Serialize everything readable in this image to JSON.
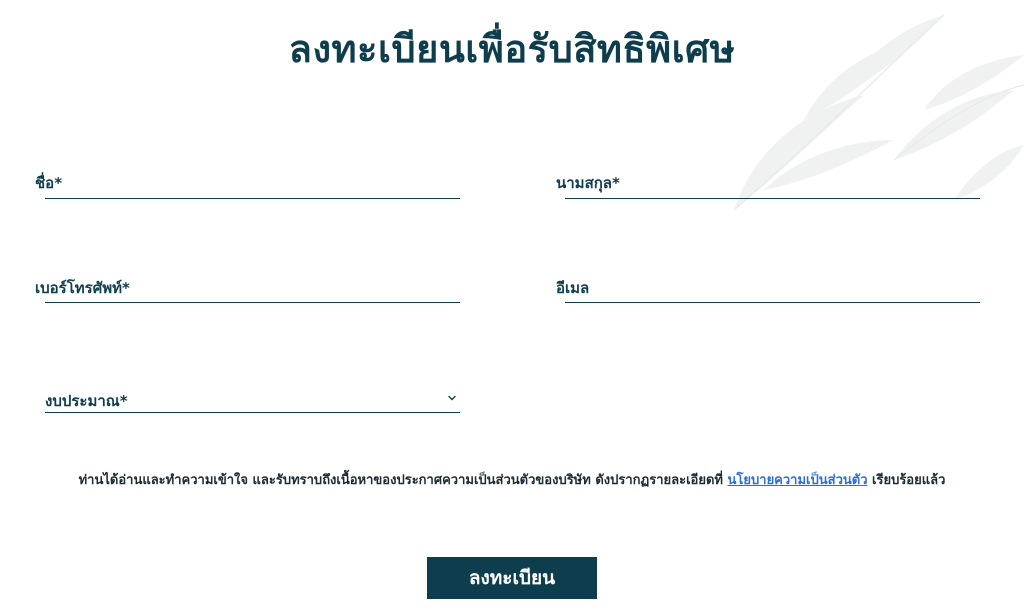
{
  "page": {
    "title": "ลงทะเบียนเพื่อรับสิทธิพิเศษ"
  },
  "form": {
    "first_name": {
      "label": "ชื่อ*",
      "value": ""
    },
    "last_name": {
      "label": "นามสกุล*",
      "value": ""
    },
    "phone": {
      "label": "เบอร์โทรศัพท์*",
      "value": ""
    },
    "email": {
      "label": "อีเมล",
      "value": ""
    },
    "budget": {
      "selected": "งบประมาณ*"
    }
  },
  "consent": {
    "text_before": "ท่านได้อ่านและทำความเข้าใจ และรับทราบถึงเนื้อหาของประกาศความเป็นส่วนตัวของบริษัท ดังปรากฏรายละเอียดที่ ",
    "link_text": "นโยบายความเป็นส่วนตัว",
    "text_after": " เรียบร้อยแล้ว"
  },
  "submit": {
    "label": "ลงทะเบียน"
  },
  "colors": {
    "primary": "#0e3d4d",
    "link": "#2a6fd6",
    "background": "#ffffff"
  },
  "icons": {
    "select_chevron": "chevron-down-icon",
    "background_decoration": "leaf-decoration"
  }
}
